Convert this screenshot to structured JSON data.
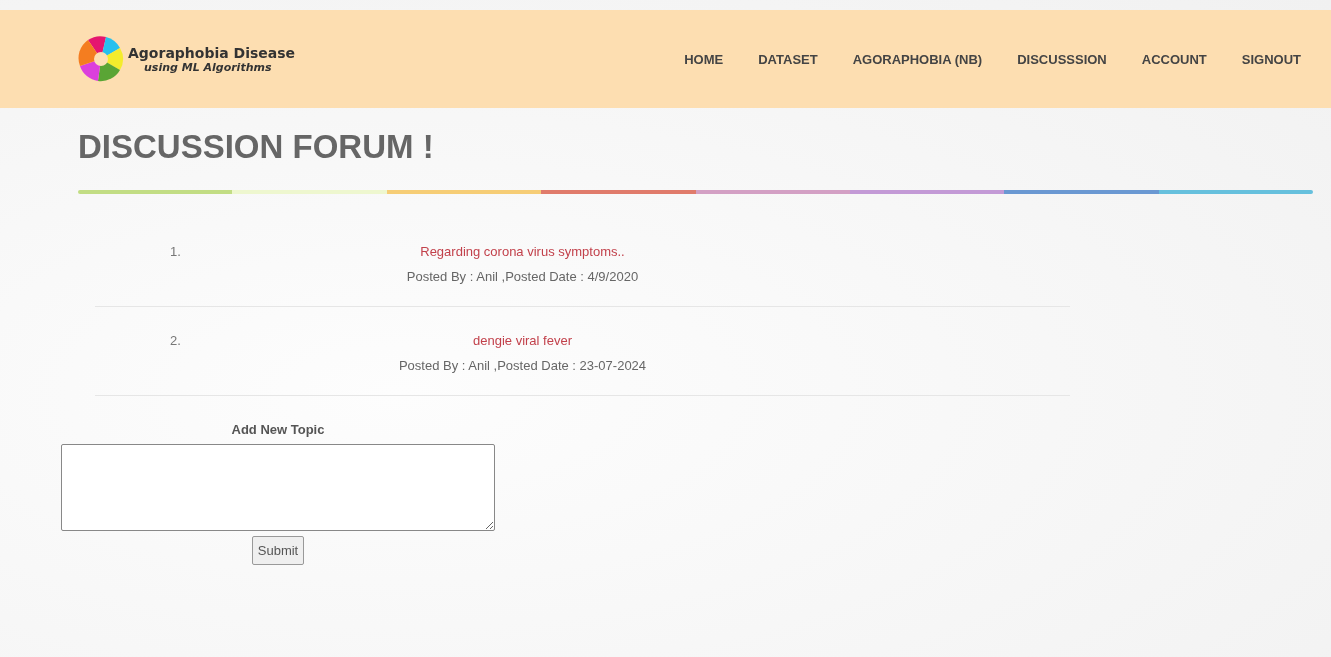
{
  "brand": {
    "title": "Agoraphobia Disease",
    "subtitle": "using ML Algorithms"
  },
  "nav": [
    {
      "label": "HOME",
      "selected": false
    },
    {
      "label": "DATASET",
      "selected": false
    },
    {
      "label": "AGORAPHOBIA (NB)",
      "selected": false
    },
    {
      "label": "DISCUSSSION",
      "selected": false
    },
    {
      "label": "ACCOUNT",
      "selected": false
    },
    {
      "label": "SIGNOUT",
      "selected": false
    }
  ],
  "heading": "DISCUSSION FORUM !",
  "topics": [
    {
      "number": "1.",
      "title": "Regarding corona virus symptoms..",
      "meta": "Posted By : Anil ,Posted Date : 4/9/2020"
    },
    {
      "number": "2.",
      "title": "dengie viral fever",
      "meta": "Posted By : Anil ,Posted Date : 23-07-2024"
    }
  ],
  "form": {
    "label": "Add New Topic",
    "button": "Submit"
  }
}
